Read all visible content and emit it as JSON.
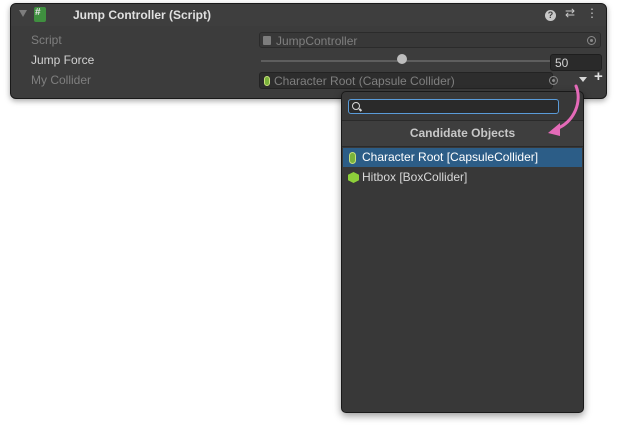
{
  "component": {
    "title": "Jump Controller (Script)"
  },
  "fields": {
    "script": {
      "label": "Script",
      "value": "JumpController"
    },
    "jump_force": {
      "label": "Jump Force",
      "value": "50",
      "slider_fraction": 0.5
    },
    "my_collider": {
      "label": "My Collider",
      "value": "Character Root (Capsule Collider)"
    }
  },
  "popup": {
    "search_value": "",
    "header": "Candidate Objects",
    "items": [
      {
        "label": "Character Root [CapsuleCollider]",
        "icon": "capsule-collider-icon",
        "selected": true
      },
      {
        "label": "Hitbox [BoxCollider]",
        "icon": "box-collider-icon",
        "selected": false
      }
    ]
  },
  "colors": {
    "accent_selected": "#2c5d87",
    "annotation_arrow": "#e46ab8",
    "search_focus": "#5a9bd8"
  }
}
